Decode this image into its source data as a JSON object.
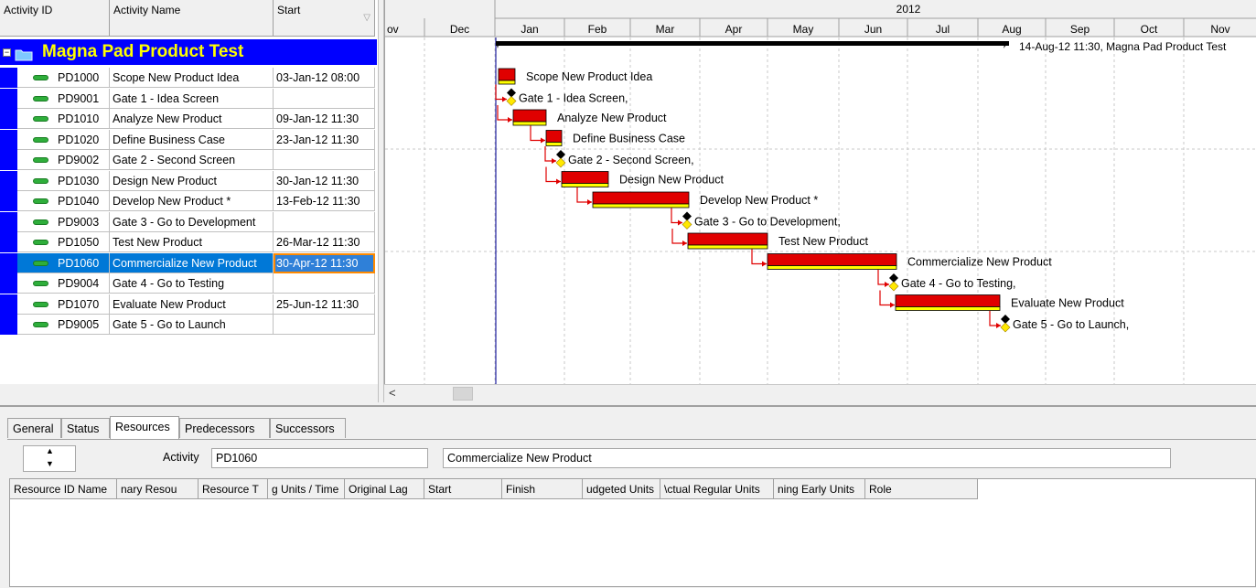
{
  "columns": {
    "activity_id": "Activity ID",
    "activity_name": "Activity Name",
    "start": "Start"
  },
  "wbs": {
    "label": "Magna Pad Product Test",
    "bar_label": "14-Aug-12 11:30, Magna Pad Product Test"
  },
  "activities": [
    {
      "id": "PD1000",
      "name": "Scope New Product Idea",
      "start": "03-Jan-12 08:00",
      "bar_label": "Scope New Product Idea"
    },
    {
      "id": "PD9001",
      "name": "Gate 1 - Idea Screen",
      "start": "",
      "bar_label": "Gate 1 - Idea Screen,"
    },
    {
      "id": "PD1010",
      "name": "Analyze New Product",
      "start": "09-Jan-12 11:30",
      "bar_label": "Analyze New Product"
    },
    {
      "id": "PD1020",
      "name": "Define Business Case",
      "start": "23-Jan-12 11:30",
      "bar_label": "Define Business Case"
    },
    {
      "id": "PD9002",
      "name": "Gate 2 - Second Screen",
      "start": "",
      "bar_label": "Gate 2 - Second Screen,"
    },
    {
      "id": "PD1030",
      "name": "Design New Product",
      "start": "30-Jan-12 11:30",
      "bar_label": "Design New Product"
    },
    {
      "id": "PD1040",
      "name": "Develop New Product *",
      "start": "13-Feb-12 11:30",
      "bar_label": "Develop New Product *"
    },
    {
      "id": "PD9003",
      "name": "Gate 3 - Go to Development",
      "start": "",
      "bar_label": "Gate 3 - Go to Development,"
    },
    {
      "id": "PD1050",
      "name": "Test New Product",
      "start": "26-Mar-12 11:30",
      "bar_label": "Test New Product"
    },
    {
      "id": "PD1060",
      "name": "Commercialize New Product",
      "start": "30-Apr-12 11:30",
      "bar_label": "Commercialize New Product"
    },
    {
      "id": "PD9004",
      "name": "Gate 4 - Go to Testing",
      "start": "",
      "bar_label": "Gate 4 - Go to Testing,"
    },
    {
      "id": "PD1070",
      "name": "Evaluate New Product",
      "start": "25-Jun-12 11:30",
      "bar_label": "Evaluate New Product"
    },
    {
      "id": "PD9005",
      "name": "Gate 5 - Go to Launch",
      "start": "",
      "bar_label": "Gate 5 - Go to Launch,"
    }
  ],
  "timescale": {
    "year": "2012",
    "months": [
      "ov",
      "Dec",
      "Jan",
      "Feb",
      "Mar",
      "Apr",
      "May",
      "Jun",
      "Jul",
      "Aug",
      "Sep",
      "Oct",
      "Nov"
    ]
  },
  "details": {
    "tabs": [
      "General",
      "Status",
      "Resources",
      "Predecessors",
      "Successors"
    ],
    "activity_label": "Activity",
    "activity_id": "PD1060",
    "activity_name": "Commercialize New Product",
    "resource_columns": [
      "Resource ID Name",
      "nary Resou",
      "Resource T",
      "g Units / Time",
      "Original Lag",
      "Start",
      "Finish",
      "udgeted Units",
      "\\ctual Regular Units",
      "ning Early Units",
      "Role"
    ]
  }
}
